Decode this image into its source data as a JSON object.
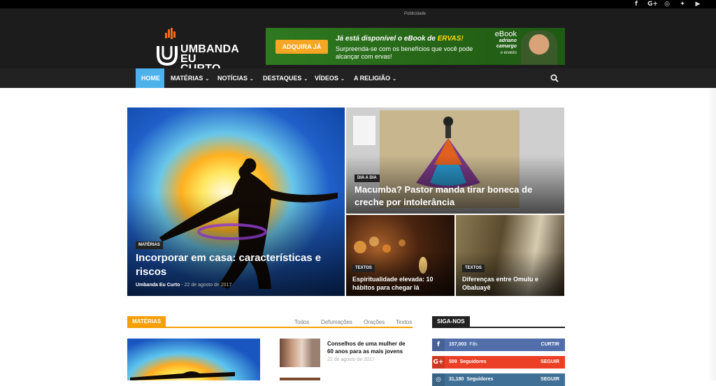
{
  "topbar": {
    "social_icons": [
      {
        "name": "facebook-icon",
        "glyph": "f"
      },
      {
        "name": "google-plus-icon",
        "glyph": "G+"
      },
      {
        "name": "instagram-icon",
        "glyph": "◎"
      },
      {
        "name": "twitter-icon",
        "glyph": "✦"
      },
      {
        "name": "youtube-icon",
        "glyph": "▶"
      }
    ]
  },
  "header": {
    "ad_label": "Publicidade",
    "logo_line1": "UMBANDA",
    "logo_line2": "EU CURTO",
    "banner": {
      "button": "ADQUIRA JÁ",
      "line1_prefix": "Já está disponível o eBook de ",
      "line1_highlight": "ERVAS!",
      "line2": "Surpreenda-se com os benefícios que você pode alcançar com ervas!",
      "ebook_title": "eBook",
      "ebook_author": "adriano camargo",
      "ebook_sub": "o erveiro"
    }
  },
  "nav": {
    "items": [
      {
        "label": "HOME",
        "caret": ""
      },
      {
        "label": "MATÉRIAS",
        "caret": "⌄"
      },
      {
        "label": "NOTÍCIAS",
        "caret": "⌄"
      },
      {
        "label": "DESTAQUES",
        "caret": "⌄"
      },
      {
        "label": "VÍDEOS",
        "caret": "⌄"
      },
      {
        "label": "A RELIGIÃO",
        "caret": "⌄"
      }
    ]
  },
  "featured": [
    {
      "tag": "MATÉRIAS",
      "title": "Incorporar em casa: características e riscos",
      "author": "Umbanda Eu Curto",
      "date": "22 de agosto de 2017"
    },
    {
      "tag": "DIA A DIA",
      "title": "Macumba? Pastor manda tirar boneca de creche por intolerância"
    },
    {
      "tag": "TEXTOS",
      "title": "Espiritualidade elevada: 10 hábitos para chegar lá"
    },
    {
      "tag": "TEXTOS",
      "title": "Diferenças entre Omulu e Obaluayê"
    }
  ],
  "materias": {
    "label": "MATÉRIAS",
    "filters": [
      "Todos",
      "Defumações",
      "Orações",
      "Textos"
    ],
    "side_items": [
      {
        "title": "Conselhos de uma mulher de 60 anos para as mais jovens",
        "date": "22 de agosto de 2017"
      }
    ]
  },
  "siga": {
    "label": "SIGA-NOS",
    "rows": [
      {
        "icon": "f",
        "count": "157,003",
        "unit": "Fãs",
        "action": "CURTIR"
      },
      {
        "icon": "G+",
        "count": "509",
        "unit": "Seguidores",
        "action": "SEGUIR"
      },
      {
        "icon": "◎",
        "count": "31,180",
        "unit": "Seguidores",
        "action": "SEGUIR"
      }
    ]
  },
  "colors": {
    "accent": "#4db2ec",
    "section": "#f4a000",
    "facebook": "#516eab",
    "googleplus": "#eb4026",
    "instagram": "#417096"
  }
}
